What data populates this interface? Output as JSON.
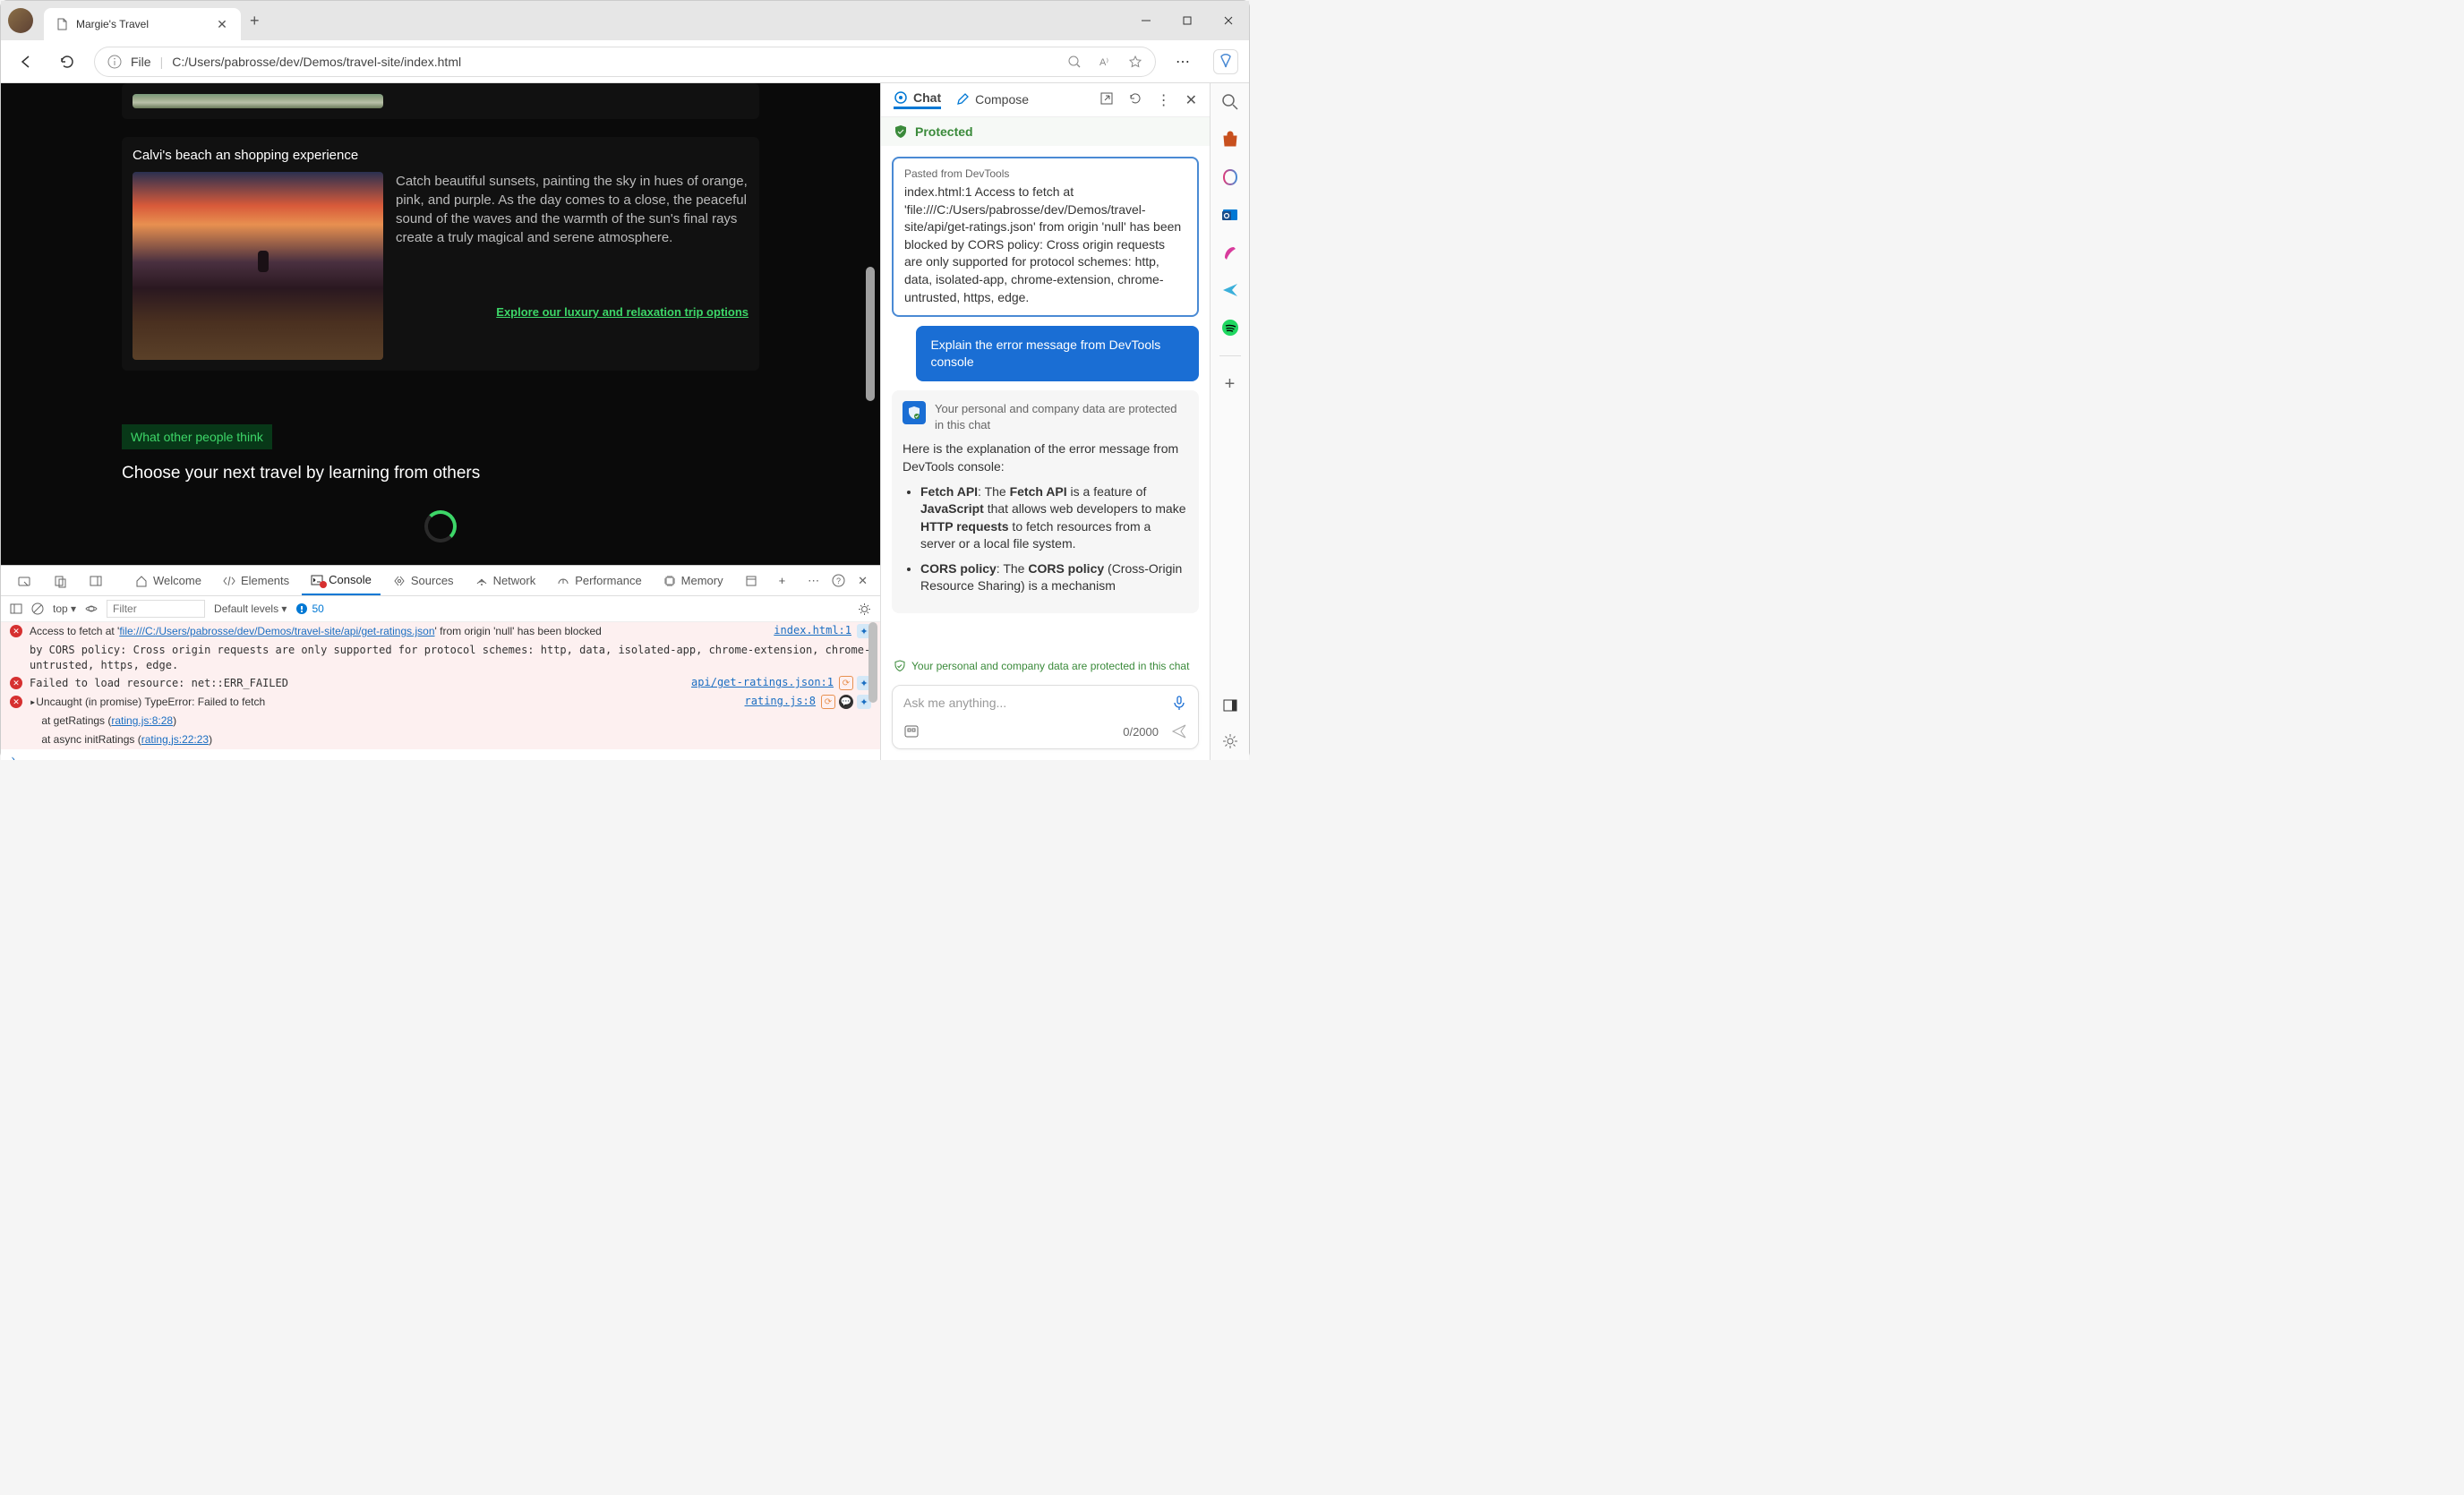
{
  "browser": {
    "tab_title": "Margie's Travel",
    "address": {
      "scheme_label": "File",
      "path": "C:/Users/pabrosse/dev/Demos/travel-site/index.html"
    }
  },
  "page": {
    "card": {
      "title": "Calvi's beach an shopping experience",
      "description": "Catch beautiful sunsets, painting the sky in hues of orange, pink, and purple. As the day comes to a close, the peaceful sound of the waves and the warmth of the sun's final rays create a truly magical and serene atmosphere.",
      "link": "Explore our luxury and relaxation trip options"
    },
    "opinions": {
      "badge": "What other people think",
      "heading": "Choose your next travel by learning from others"
    }
  },
  "devtools": {
    "tabs": {
      "welcome": "Welcome",
      "elements": "Elements",
      "console": "Console",
      "sources": "Sources",
      "network": "Network",
      "performance": "Performance",
      "memory": "Memory"
    },
    "filter": {
      "top": "top",
      "placeholder": "Filter",
      "levels": "Default levels",
      "msg_count": "50"
    },
    "msg1": {
      "prefix": "Access to fetch at '",
      "url": "file:///C:/Users/pabrosse/dev/Demos/travel-site/api/get-ratings.json",
      "mid": "' from origin 'null' has been blocked",
      "src": "index.html:1",
      "cont": "by CORS policy: Cross origin requests are only supported for protocol schemes: http, data, isolated-app, chrome-extension, chrome-untrusted, https, edge."
    },
    "msg2": {
      "text": "Failed to load resource: net::ERR_FAILED",
      "src": "api/get-ratings.json:1"
    },
    "msg3": {
      "line1": "Uncaught (in promise) TypeError: Failed to fetch",
      "at1_pre": "    at getRatings (",
      "at1_link": "rating.js:8:28",
      "at1_post": ")",
      "at2_pre": "    at async initRatings (",
      "at2_link": "rating.js:22:23",
      "at2_post": ")",
      "src": "rating.js:8"
    }
  },
  "copilot": {
    "tabs": {
      "chat": "Chat",
      "compose": "Compose"
    },
    "protected": "Protected",
    "pasted": {
      "header": "Pasted from DevTools",
      "body": "index.html:1 Access to fetch at 'file:///C:/Users/pabrosse/dev/Demos/travel-site/api/get-ratings.json' from origin 'null' has been blocked by CORS policy: Cross origin requests are only supported for protocol schemes: http, data, isolated-app, chrome-extension, chrome-untrusted, https, edge."
    },
    "user_msg": "Explain the error message from DevTools console",
    "response": {
      "subhead": "Your personal and company data are protected in this chat",
      "intro": "Here is the explanation of the error message from DevTools console:",
      "bullet1_a": "Fetch API",
      "bullet1_b": ": The ",
      "bullet1_c": "Fetch API",
      "bullet1_d": " is a feature of ",
      "bullet1_e": "JavaScript",
      "bullet1_f": " that allows web developers to make ",
      "bullet1_g": "HTTP requests",
      "bullet1_h": " to fetch resources from a server or a local file system.",
      "bullet2_a": "CORS policy",
      "bullet2_b": ": The ",
      "bullet2_c": "CORS policy",
      "bullet2_d": " (Cross-Origin Resource Sharing) is a mechanism"
    },
    "footer_protect": "Your personal and company data are protected in this chat",
    "input": {
      "placeholder": "Ask me anything...",
      "count": "0/2000"
    }
  }
}
